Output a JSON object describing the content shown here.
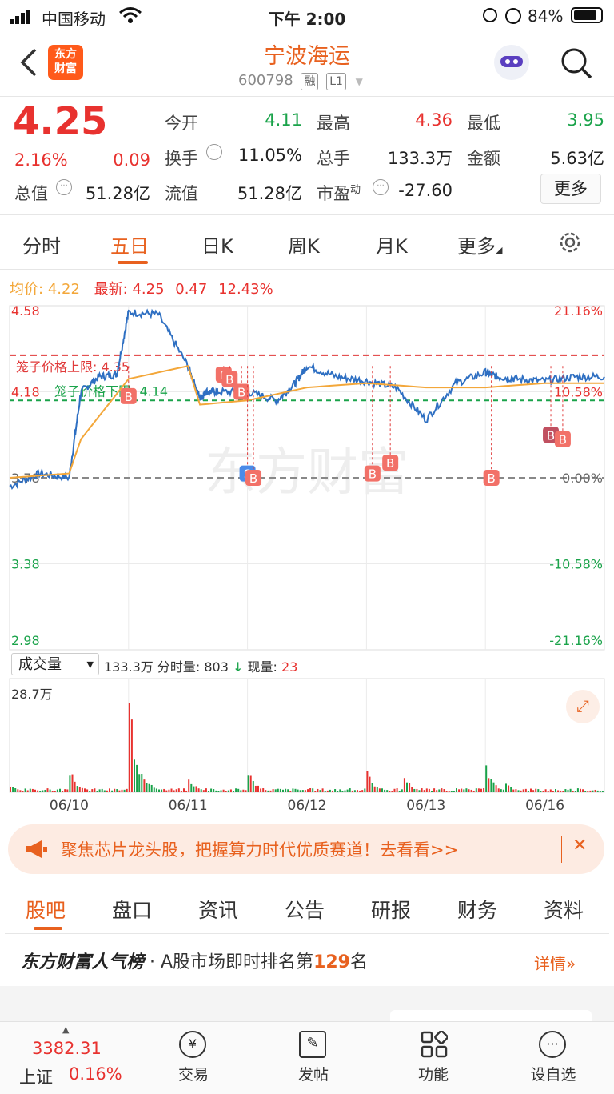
{
  "status_bar": {
    "carrier": "中国移动",
    "time": "下午 2:00",
    "battery": "84%"
  },
  "header": {
    "title": "宁波海运",
    "code": "600798",
    "tag_margin": "融",
    "tag_level": "L1",
    "logo_line1": "东方",
    "logo_line2": "财富"
  },
  "quote": {
    "price": "4.25",
    "change_pct": "2.16%",
    "change_amt": "0.09",
    "open_label": "今开",
    "open": "4.11",
    "high_label": "最高",
    "high": "4.36",
    "low_label": "最低",
    "low": "3.95",
    "turnover_label": "换手",
    "turnover": "11.05%",
    "volume_label": "总手",
    "volume": "133.3万",
    "amount_label": "金额",
    "amount": "5.63亿",
    "mktcap_label": "总值",
    "mktcap": "51.28亿",
    "float_label": "流值",
    "float": "51.28亿",
    "pe_label": "市盈",
    "pe_sup": "动",
    "pe": "-27.60",
    "more_label": "更多"
  },
  "tabs": [
    "分时",
    "五日",
    "日K",
    "周K",
    "月K",
    "更多"
  ],
  "chart": {
    "avg_label": "均价:",
    "avg": "4.22",
    "latest_label": "最新:",
    "latest": "4.25",
    "latest_change": "0.47",
    "latest_pct": "12.43%",
    "y_left": [
      "4.58",
      "4.18",
      "3.78",
      "3.38",
      "2.98"
    ],
    "y_right": [
      "21.16%",
      "10.58%",
      "0.00%",
      "-10.58%",
      "-21.16%"
    ],
    "upper_limit_label": "笼子价格上限: 4.35",
    "lower_limit_label": "笼子价格下限: 4.14",
    "watermark": "东方财富",
    "vol_select": "成交量",
    "vol_summary": "133.3万 分时量: 803",
    "vol_now_label": "现量:",
    "vol_now": "23",
    "vol_max": "28.7万",
    "dates": [
      "06/10",
      "06/11",
      "06/12",
      "06/13",
      "06/16"
    ],
    "marker_b": "B",
    "marker_s": "S",
    "colors": {
      "price": "#2e6fc2",
      "avg": "#f3a73a",
      "limit_upper": "#e03a3a",
      "limit_lower": "#1aa34a",
      "baseline": "#888888"
    }
  },
  "chart_data": {
    "type": "line",
    "title": "",
    "xlabel": "",
    "ylabel": "",
    "ylim": [
      2.98,
      4.58
    ],
    "categories": [
      "06/10",
      "06/11",
      "06/12",
      "06/13",
      "06/16"
    ],
    "series": [
      {
        "name": "",
        "x": [
          0,
          0.05,
          0.1,
          0.12,
          0.15,
          0.18,
          0.2,
          0.25,
          0.3,
          0.32,
          0.33,
          0.35,
          0.4,
          0.45,
          0.48,
          0.5,
          0.55,
          0.6,
          0.65,
          0.7,
          0.75,
          0.8,
          0.82,
          0.85,
          0.9,
          0.95,
          1.0
        ],
        "values": [
          3.74,
          3.8,
          3.78,
          4.18,
          4.25,
          4.26,
          4.55,
          4.54,
          4.3,
          4.15,
          4.18,
          4.18,
          4.18,
          4.14,
          4.22,
          4.3,
          4.25,
          4.23,
          4.2,
          4.05,
          4.22,
          4.27,
          4.25,
          4.24,
          4.23,
          4.25,
          4.25
        ]
      },
      {
        "name": "",
        "x": [
          0,
          0.1,
          0.12,
          0.2,
          0.3,
          0.32,
          0.4,
          0.5,
          0.6,
          0.7,
          0.8,
          0.9,
          1.0
        ],
        "values": [
          3.78,
          3.8,
          3.96,
          4.24,
          4.3,
          4.12,
          4.14,
          4.2,
          4.22,
          4.2,
          4.2,
          4.22,
          4.22
        ]
      }
    ]
  },
  "ad": {
    "text": "聚焦芯片龙头股，把握算力时代优质赛道！去看看>>",
    "close": "✕"
  },
  "subtabs": [
    "股吧",
    "盘口",
    "资讯",
    "公告",
    "研报",
    "财务",
    "资料"
  ],
  "rank": {
    "brand": "东方财富人气榜",
    "text_pre": "· A股市场即时排名第",
    "num": "129",
    "text_post": "名",
    "detail": "详情"
  },
  "bottom": {
    "index_value": "3382.31",
    "index_name": "上证",
    "index_pct": "0.16%",
    "items": [
      "交易",
      "发帖",
      "功能",
      "设自选"
    ]
  }
}
